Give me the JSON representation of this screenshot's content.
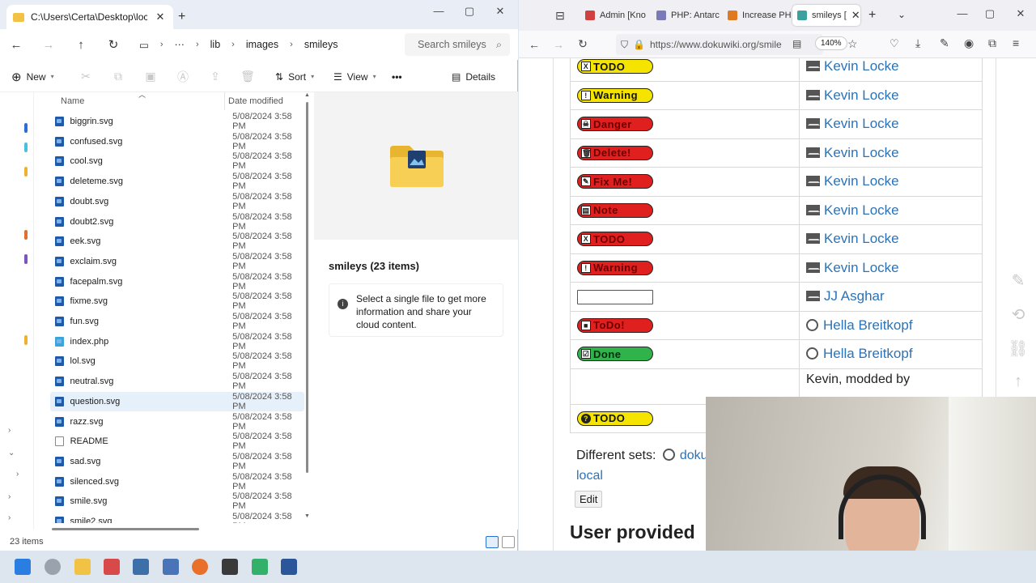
{
  "explorer": {
    "tab_title": "C:\\Users\\Certa\\Desktop\\local\\",
    "breadcrumbs": [
      "lib",
      "images",
      "smileys"
    ],
    "search_placeholder": "Search smileys",
    "commands": {
      "new": "New",
      "sort": "Sort",
      "view": "View",
      "more": "•••",
      "details": "Details"
    },
    "columns": {
      "name": "Name",
      "date": "Date modified"
    },
    "files": [
      {
        "name": "biggrin.svg",
        "date": "5/08/2024 3:58 PM",
        "type": "svg"
      },
      {
        "name": "confused.svg",
        "date": "5/08/2024 3:58 PM",
        "type": "svg"
      },
      {
        "name": "cool.svg",
        "date": "5/08/2024 3:58 PM",
        "type": "svg"
      },
      {
        "name": "deleteme.svg",
        "date": "5/08/2024 3:58 PM",
        "type": "svg"
      },
      {
        "name": "doubt.svg",
        "date": "5/08/2024 3:58 PM",
        "type": "svg"
      },
      {
        "name": "doubt2.svg",
        "date": "5/08/2024 3:58 PM",
        "type": "svg"
      },
      {
        "name": "eek.svg",
        "date": "5/08/2024 3:58 PM",
        "type": "svg"
      },
      {
        "name": "exclaim.svg",
        "date": "5/08/2024 3:58 PM",
        "type": "svg"
      },
      {
        "name": "facepalm.svg",
        "date": "5/08/2024 3:58 PM",
        "type": "svg"
      },
      {
        "name": "fixme.svg",
        "date": "5/08/2024 3:58 PM",
        "type": "svg"
      },
      {
        "name": "fun.svg",
        "date": "5/08/2024 3:58 PM",
        "type": "svg"
      },
      {
        "name": "index.php",
        "date": "5/08/2024 3:58 PM",
        "type": "php"
      },
      {
        "name": "lol.svg",
        "date": "5/08/2024 3:58 PM",
        "type": "svg"
      },
      {
        "name": "neutral.svg",
        "date": "5/08/2024 3:58 PM",
        "type": "svg"
      },
      {
        "name": "question.svg",
        "date": "5/08/2024 3:58 PM",
        "type": "svg",
        "selected": true
      },
      {
        "name": "razz.svg",
        "date": "5/08/2024 3:58 PM",
        "type": "svg"
      },
      {
        "name": "README",
        "date": "5/08/2024 3:58 PM",
        "type": "txt"
      },
      {
        "name": "sad.svg",
        "date": "5/08/2024 3:58 PM",
        "type": "svg"
      },
      {
        "name": "silenced.svg",
        "date": "5/08/2024 3:58 PM",
        "type": "svg"
      },
      {
        "name": "smile.svg",
        "date": "5/08/2024 3:58 PM",
        "type": "svg"
      },
      {
        "name": "smile2.svg",
        "date": "5/08/2024 3:58 PM",
        "type": "svg"
      }
    ],
    "preview": {
      "title": "smileys (23 items)",
      "info": "Select a single file to get more information and share your cloud content."
    },
    "status": "23 items"
  },
  "browser": {
    "tabs": [
      {
        "label": "Admin [Kno",
        "color": "#d04040"
      },
      {
        "label": "PHP: Antarc",
        "color": "#7a7ab8"
      },
      {
        "label": "Increase PH",
        "color": "#e07a20"
      },
      {
        "label": "smileys [",
        "color": "#3aa0a0",
        "active": true
      }
    ],
    "url": "https://www.dokuwiki.org/smile",
    "zoom": "140%",
    "rows": [
      {
        "badge": "TODO",
        "style": "b-yellow",
        "box": "X",
        "author": "Kevin Locke",
        "icon": "mail"
      },
      {
        "badge": "Warning",
        "style": "b-yellow",
        "box": "!",
        "author": "Kevin Locke",
        "icon": "mail"
      },
      {
        "badge": "Danger",
        "style": "b-red",
        "box": "☠",
        "author": "Kevin Locke",
        "icon": "mail"
      },
      {
        "badge": "Delete!",
        "style": "b-red",
        "box": "🗑",
        "author": "Kevin Locke",
        "icon": "mail"
      },
      {
        "badge": "Fix Me!",
        "style": "b-red",
        "box": "✎",
        "author": "Kevin Locke",
        "icon": "mail"
      },
      {
        "badge": "Note",
        "style": "b-red",
        "box": "▤",
        "author": "Kevin Locke",
        "icon": "mail"
      },
      {
        "badge": "TODO",
        "style": "b-red",
        "box": "X",
        "author": "Kevin Locke",
        "icon": "mail"
      },
      {
        "badge": "Warning",
        "style": "b-red",
        "box": "!",
        "author": "Kevin Locke",
        "icon": "mail"
      },
      {
        "badge": "",
        "style": "b-empty",
        "box": "",
        "author": "JJ Asghar",
        "icon": "mail"
      },
      {
        "badge": "ToDo!",
        "style": "b-red",
        "box": "■",
        "author": "Hella Breitkopf",
        "icon": "globe"
      },
      {
        "badge": "Done",
        "style": "b-green",
        "box": "☑",
        "author": "Hella Breitkopf",
        "icon": "globe"
      }
    ],
    "plain_cell": "Kevin, modded by",
    "question_badge": "TODO",
    "different_sets": "Different sets:",
    "doku_link": "doku",
    "local_link": "local",
    "edit_label": "Edit",
    "heading": "User provided"
  }
}
